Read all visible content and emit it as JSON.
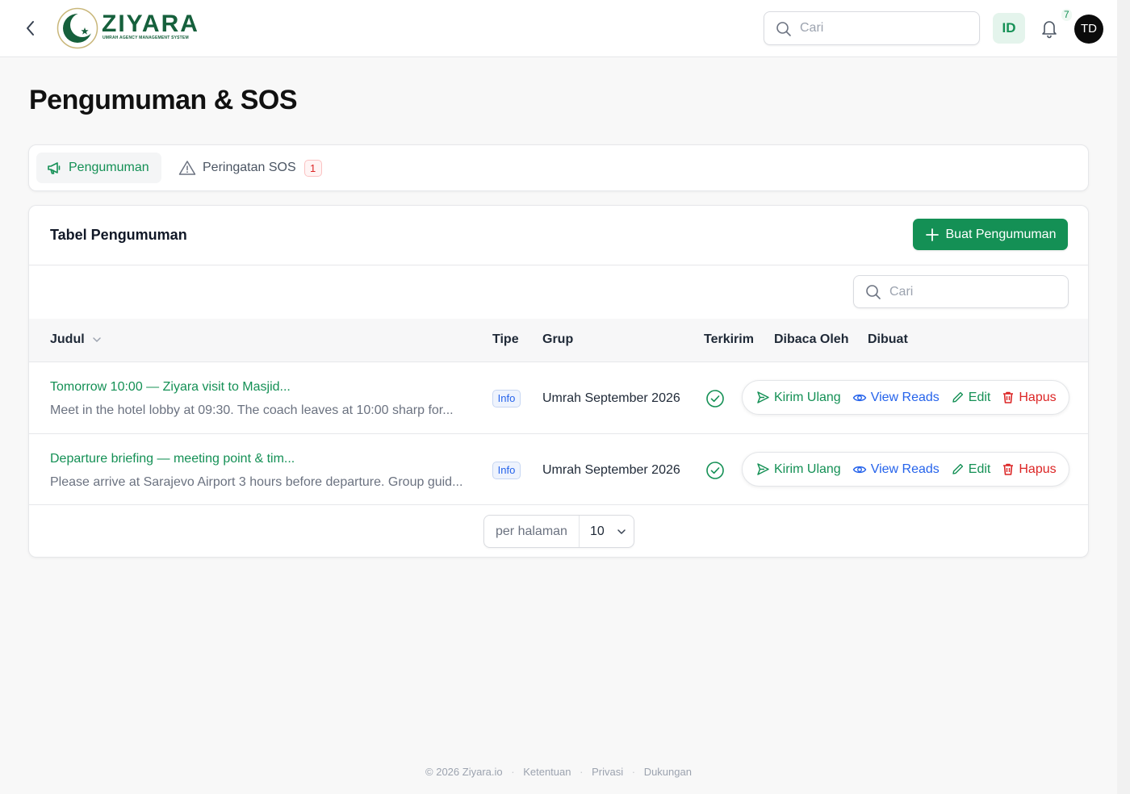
{
  "header": {
    "logo_word": "ZIYARA",
    "logo_tagline": "UMRAH AGENCY MANAGEMENT SYSTEM",
    "search_placeholder": "Cari",
    "language": "ID",
    "notification_count": "7",
    "user_initials": "TD",
    "icons": {
      "back": "chevron-left-icon",
      "search": "search-icon",
      "bell": "bell-icon"
    }
  },
  "page": {
    "title": "Pengumuman & SOS"
  },
  "tabs": [
    {
      "label": "Pengumuman",
      "icon": "megaphone-icon",
      "active": true
    },
    {
      "label": "Peringatan SOS",
      "icon": "warning-triangle-icon",
      "badge": "1",
      "active": false
    }
  ],
  "table_card": {
    "title": "Tabel Pengumuman",
    "create_button": "Buat Pengumuman",
    "search_placeholder": "Cari",
    "columns": [
      "Judul",
      "Tipe",
      "Grup",
      "Terkirim",
      "Dibaca Oleh",
      "Dibuat"
    ],
    "rows": [
      {
        "title": "Tomorrow 10:00 — Ziyara visit to Masjid...",
        "body": "Meet in the hotel lobby at 09:30. The coach leaves at 10:00 sharp for...",
        "type": "Info",
        "group": "Umrah September 2026",
        "sent": true
      },
      {
        "title": "Departure briefing — meeting point & tim...",
        "body": "Please arrive at Sarajevo Airport 3 hours before departure. Group guid...",
        "type": "Info",
        "group": "Umrah September 2026",
        "sent": true
      }
    ],
    "actions": {
      "resend": "Kirim Ulang",
      "view_reads": "View Reads",
      "edit": "Edit",
      "delete": "Hapus"
    },
    "pagination": {
      "label": "per halaman",
      "value": "10"
    }
  },
  "footer": {
    "copyright": "© 2026 Ziyara.io",
    "links": [
      "Ketentuan",
      "Privasi",
      "Dukungan"
    ]
  },
  "colors": {
    "brand_green": "#149055",
    "link_blue": "#2563eb",
    "danger_red": "#dc2626",
    "logo_green": "#16603c"
  }
}
